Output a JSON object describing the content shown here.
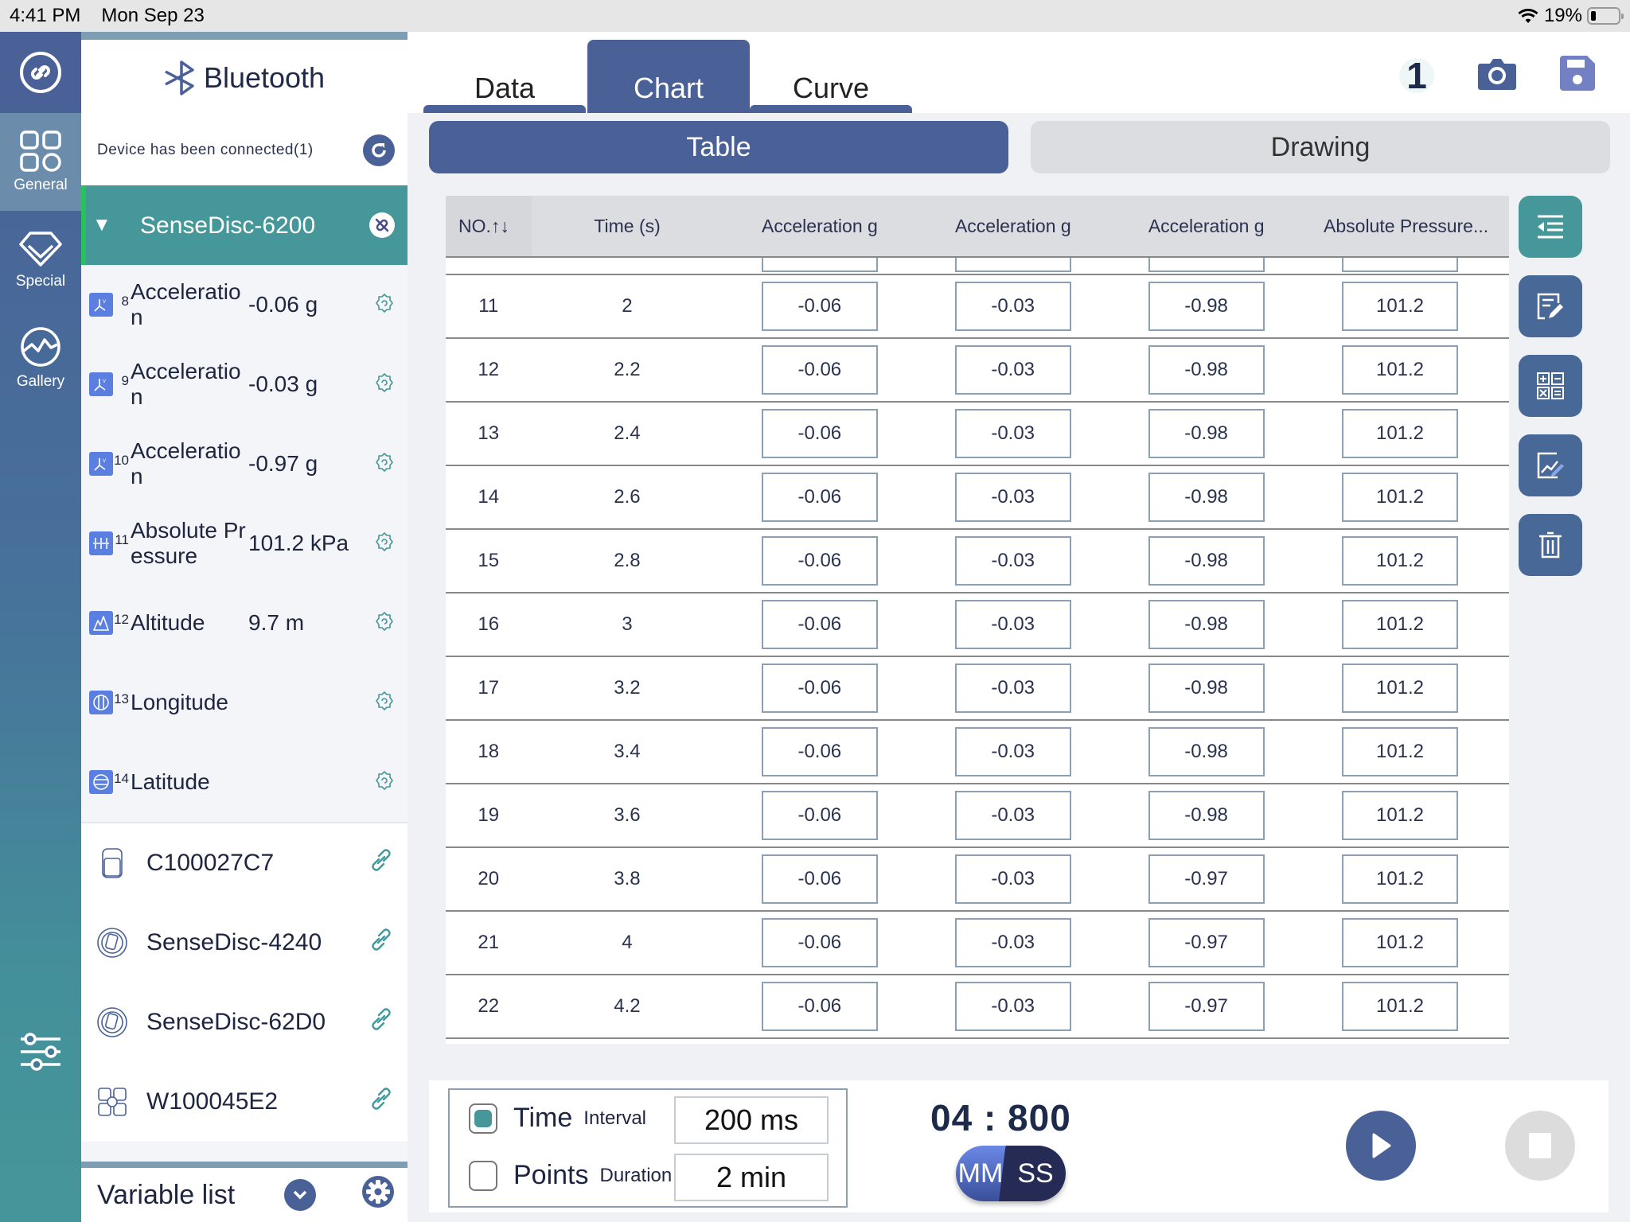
{
  "status_bar": {
    "time": "4:41 PM",
    "date": "Mon Sep 23",
    "battery": "19%",
    "battery_level": 0.19
  },
  "rail": {
    "items": [
      {
        "label": "General",
        "icon": "grid-icon",
        "active": true
      },
      {
        "label": "Special",
        "icon": "diamond-icon",
        "active": false
      },
      {
        "label": "Gallery",
        "icon": "wave-icon",
        "active": false
      }
    ]
  },
  "panel": {
    "title": "Bluetooth",
    "connected_text": "Device has been connected(1)",
    "active_device": "SenseDisc-6200",
    "variables": [
      {
        "num": "8",
        "name": "Acceleration",
        "value": "-0.06 g",
        "icon": "acceleration-icon"
      },
      {
        "num": "9",
        "name": "Acceleration",
        "value": "-0.03 g",
        "icon": "acceleration-icon"
      },
      {
        "num": "10",
        "name": "Acceleration",
        "value": "-0.97 g",
        "icon": "acceleration-icon"
      },
      {
        "num": "11",
        "name": "Absolute Pressure",
        "value": "101.2 kPa",
        "icon": "pressure-icon"
      },
      {
        "num": "12",
        "name": "Altitude",
        "value": "9.7 m",
        "icon": "altitude-icon"
      },
      {
        "num": "13",
        "name": "Longitude",
        "value": "",
        "icon": "longitude-icon"
      },
      {
        "num": "14",
        "name": "Latitude",
        "value": "",
        "icon": "latitude-icon"
      }
    ],
    "devices": [
      {
        "name": "C100027C7",
        "icon": "sensor-box-icon"
      },
      {
        "name": "SenseDisc-4240",
        "icon": "sensedisc-icon"
      },
      {
        "name": "SenseDisc-62D0",
        "icon": "sensedisc-icon"
      },
      {
        "name": "W100045E2",
        "icon": "weather-station-icon"
      }
    ],
    "variable_list_label": "Variable list"
  },
  "tabs": [
    {
      "label": "Data",
      "active": false
    },
    {
      "label": "Chart",
      "active": true
    },
    {
      "label": "Curve",
      "active": false
    }
  ],
  "toolbar": {
    "counter": "1"
  },
  "view_toggle": {
    "table": "Table",
    "drawing": "Drawing",
    "active": "Table"
  },
  "table": {
    "headers": [
      "NO.↑↓",
      "Time (s)",
      "Acceleration g",
      "Acceleration g",
      "Acceleration g",
      "Absolute Pressure..."
    ],
    "rows": [
      [
        "11",
        "2",
        "-0.06",
        "-0.03",
        "-0.98",
        "101.2"
      ],
      [
        "12",
        "2.2",
        "-0.06",
        "-0.03",
        "-0.98",
        "101.2"
      ],
      [
        "13",
        "2.4",
        "-0.06",
        "-0.03",
        "-0.98",
        "101.2"
      ],
      [
        "14",
        "2.6",
        "-0.06",
        "-0.03",
        "-0.98",
        "101.2"
      ],
      [
        "15",
        "2.8",
        "-0.06",
        "-0.03",
        "-0.98",
        "101.2"
      ],
      [
        "16",
        "3",
        "-0.06",
        "-0.03",
        "-0.98",
        "101.2"
      ],
      [
        "17",
        "3.2",
        "-0.06",
        "-0.03",
        "-0.98",
        "101.2"
      ],
      [
        "18",
        "3.4",
        "-0.06",
        "-0.03",
        "-0.98",
        "101.2"
      ],
      [
        "19",
        "3.6",
        "-0.06",
        "-0.03",
        "-0.98",
        "101.2"
      ],
      [
        "20",
        "3.8",
        "-0.06",
        "-0.03",
        "-0.97",
        "101.2"
      ],
      [
        "21",
        "4",
        "-0.06",
        "-0.03",
        "-0.97",
        "101.2"
      ],
      [
        "22",
        "4.2",
        "-0.06",
        "-0.03",
        "-0.97",
        "101.2"
      ]
    ]
  },
  "side_tools": [
    {
      "name": "collapse-columns",
      "icon": "indent-icon"
    },
    {
      "name": "edit-notes",
      "icon": "edit-document-icon"
    },
    {
      "name": "calculator",
      "icon": "calculator-icon"
    },
    {
      "name": "draw-chart",
      "icon": "chart-edit-icon"
    },
    {
      "name": "delete",
      "icon": "trash-icon"
    }
  ],
  "recording": {
    "time_mode": {
      "label": "Time",
      "sub": "Interval",
      "value": "200 ms",
      "selected": true
    },
    "points_mode": {
      "label": "Points",
      "sub": "Duration",
      "value": "2 min",
      "selected": false
    },
    "timer": "04 : 800",
    "unit_toggle": {
      "left": "MM",
      "right": "SS"
    }
  }
}
